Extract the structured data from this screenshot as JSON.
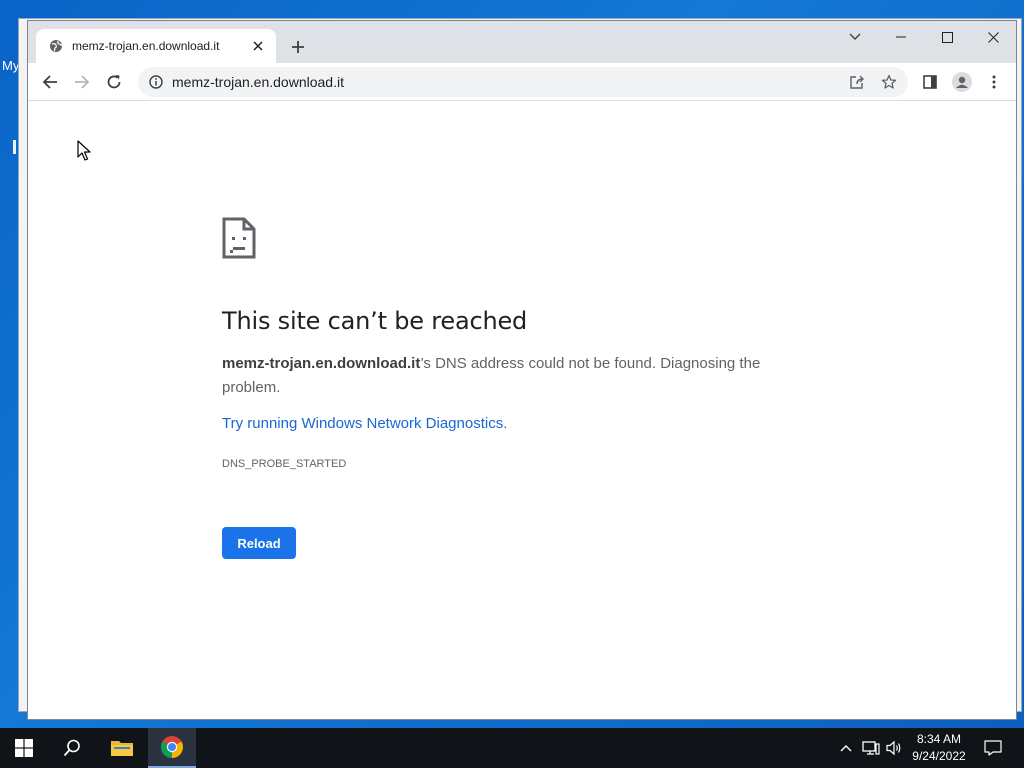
{
  "desktop": {
    "icon_label": "My"
  },
  "browser": {
    "tab": {
      "title": "memz-trojan.en.download.it"
    },
    "omnibox": {
      "url": "memz-trojan.en.download.it"
    }
  },
  "error_page": {
    "heading": "This site can’t be reached",
    "host": "memz-trojan.en.download.it",
    "description": "’s DNS address could not be found. Diagnosing the problem.",
    "link_text": "Try running Windows Network Diagnostics",
    "link_suffix": ".",
    "error_code": "DNS_PROBE_STARTED",
    "reload_label": "Reload"
  },
  "taskbar": {
    "time": "8:34 AM",
    "date": "9/24/2022"
  },
  "colors": {
    "accent": "#1a73e8",
    "link": "#1967d2",
    "taskbar": "#101318",
    "desktop": "#1478d4"
  }
}
